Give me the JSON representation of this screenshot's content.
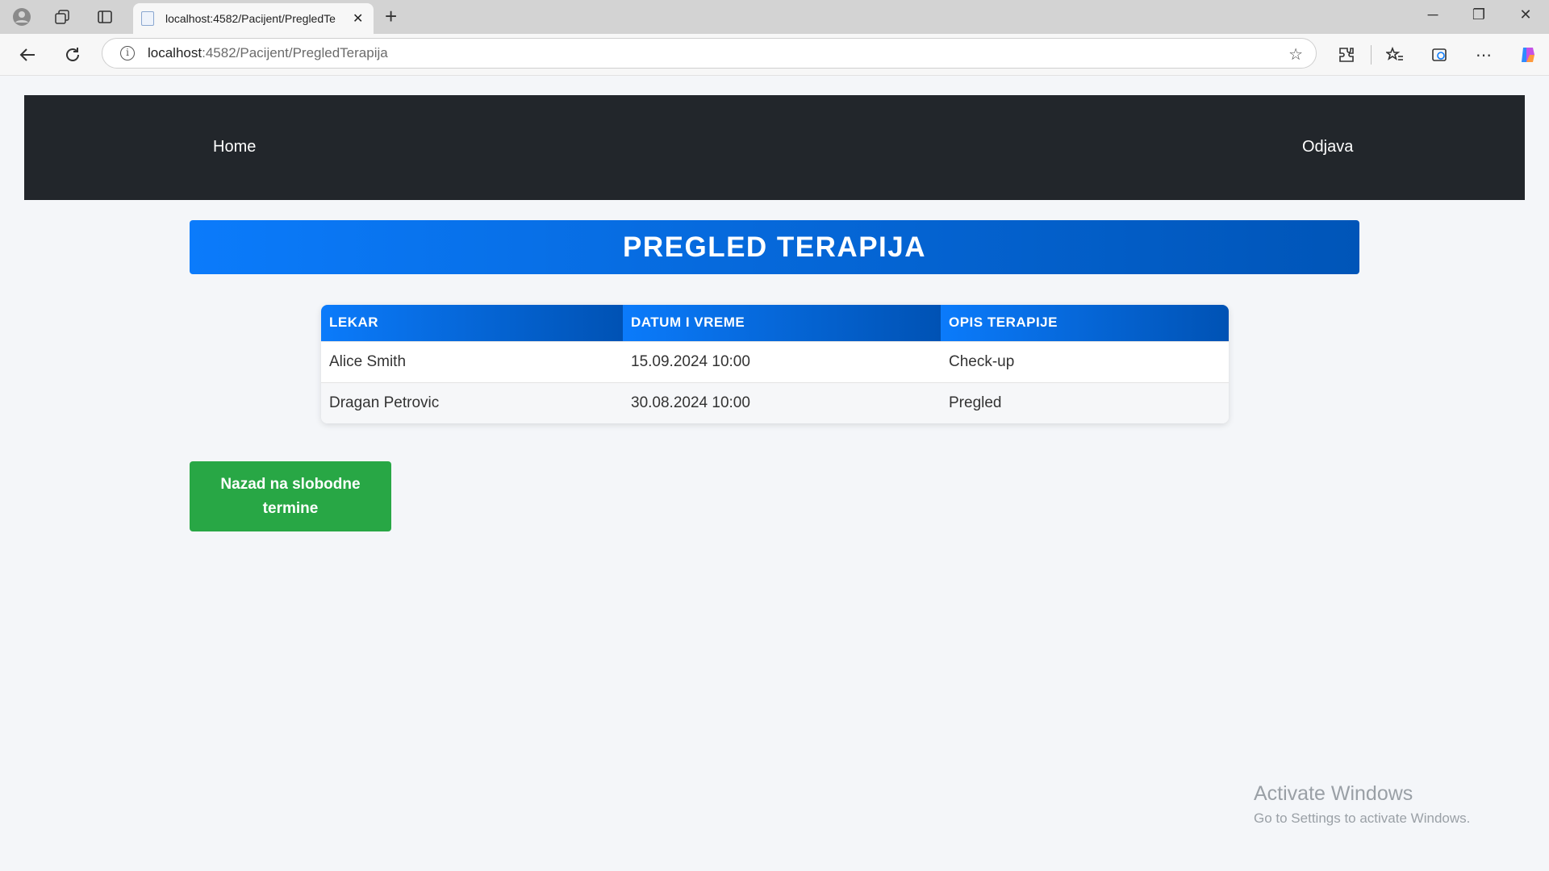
{
  "browser": {
    "tab_title": "localhost:4582/Pacijent/PregledTe",
    "url_host": "localhost",
    "url_rest": ":4582/Pacijent/PregledTerapija"
  },
  "navbar": {
    "home": "Home",
    "logout": "Odjava"
  },
  "page": {
    "title": "PREGLED TERAPIJA",
    "back_button": "Nazad na slobodne termine"
  },
  "table": {
    "headers": [
      "LEKAR",
      "DATUM I VREME",
      "OPIS TERAPIJE"
    ],
    "rows": [
      [
        "Alice Smith",
        "15.09.2024 10:00",
        "Check-up"
      ],
      [
        "Dragan Petrovic",
        "30.08.2024 10:00",
        "Pregled"
      ]
    ]
  },
  "watermark": {
    "title": "Activate Windows",
    "subtitle": "Go to Settings to activate Windows."
  },
  "colors": {
    "navbar_bg": "#22262b",
    "primary": "#0b7bfb",
    "success": "#28a745"
  }
}
